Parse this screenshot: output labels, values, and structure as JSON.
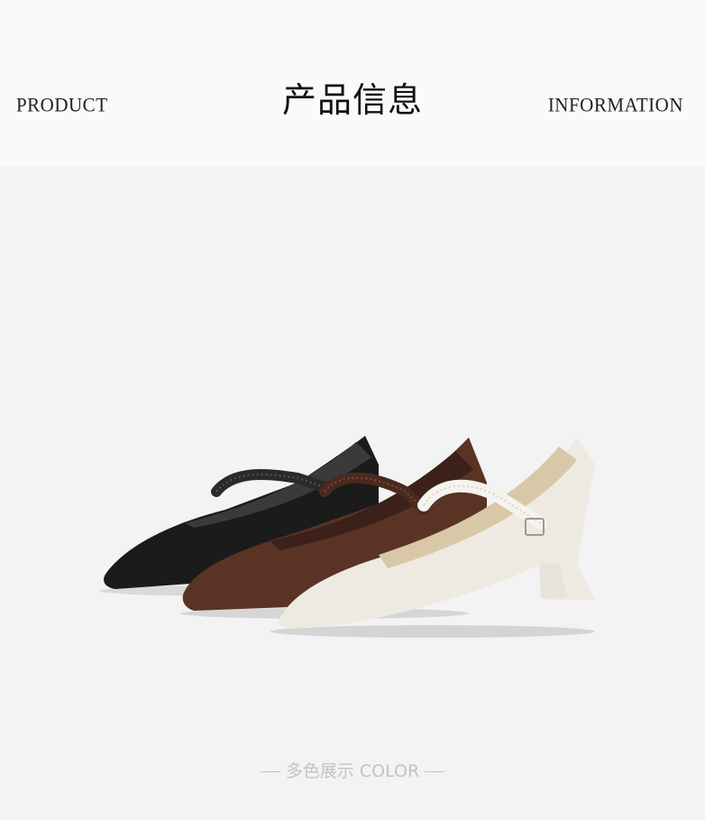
{
  "header": {
    "left_word": "PRODUCT",
    "title": "产品信息",
    "right_word": "INFORMATION"
  },
  "product": {
    "colors": {
      "black": "#1a1a1a",
      "brown": "#5b3426",
      "cream": "#efebe3"
    }
  },
  "caption": {
    "text": "多色展示 COLOR"
  }
}
